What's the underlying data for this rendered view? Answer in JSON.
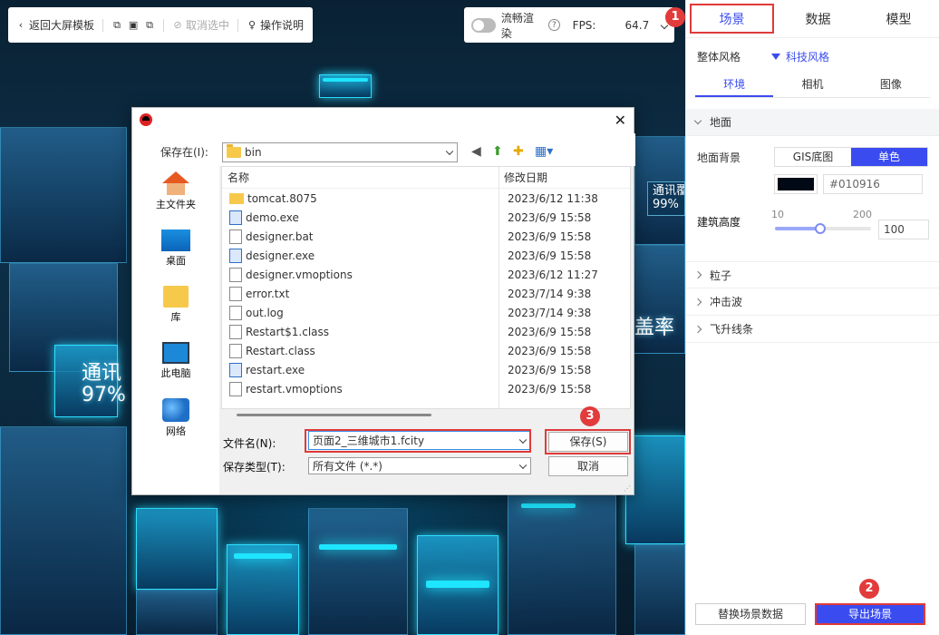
{
  "toolbar": {
    "back_label": "返回大屏模板",
    "deselect_label": "取消选中",
    "help_label": "操作说明"
  },
  "fps_bar": {
    "smooth_label": "流畅渲染",
    "fps_label": "FPS:",
    "fps_value": "64.7"
  },
  "scene_labels": {
    "label_1_title": "通讯",
    "label_1_value": "97%",
    "label_2_title": "通讯覆",
    "label_2_value": "99%",
    "label_3": "盖率"
  },
  "panel": {
    "tabs": [
      "场景",
      "数据",
      "模型"
    ],
    "style_label": "整体风格",
    "style_value": "科技风格",
    "subtabs": [
      "环境",
      "相机",
      "图像"
    ],
    "ground_section": "地面",
    "ground_bg_label": "地面背景",
    "ground_bg_options": [
      "GIS底图",
      "单色"
    ],
    "ground_color": "#010916",
    "ground_hex": "#010916",
    "building_height_label": "建筑高度",
    "slider_min": "10",
    "slider_max": "200",
    "building_height_value": "100",
    "slider_fraction": 0.47,
    "sections": [
      "粒子",
      "冲击波",
      "飞升线条"
    ],
    "replace_button": "替换场景数据",
    "export_button": "导出场景"
  },
  "badges": [
    "1",
    "2",
    "3"
  ],
  "dialog": {
    "save_in_label": "保存在(I):",
    "current_folder": "bin",
    "places": [
      "主文件夹",
      "桌面",
      "库",
      "此电脑",
      "网络"
    ],
    "col_name": "名称",
    "col_date": "修改日期",
    "files": [
      {
        "name": "tomcat.8075",
        "date": "2023/6/12 11:38",
        "icon": "folder"
      },
      {
        "name": "demo.exe",
        "date": "2023/6/9 15:58",
        "icon": "exe"
      },
      {
        "name": "designer.bat",
        "date": "2023/6/9 15:58",
        "icon": "bat"
      },
      {
        "name": "designer.exe",
        "date": "2023/6/9 15:58",
        "icon": "exe"
      },
      {
        "name": "designer.vmoptions",
        "date": "2023/6/12 11:27",
        "icon": "file"
      },
      {
        "name": "error.txt",
        "date": "2023/7/14 9:38",
        "icon": "file"
      },
      {
        "name": "out.log",
        "date": "2023/7/14 9:38",
        "icon": "file"
      },
      {
        "name": "Restart$1.class",
        "date": "2023/6/9 15:58",
        "icon": "file"
      },
      {
        "name": "Restart.class",
        "date": "2023/6/9 15:58",
        "icon": "file"
      },
      {
        "name": "restart.exe",
        "date": "2023/6/9 15:58",
        "icon": "exe"
      },
      {
        "name": "restart.vmoptions",
        "date": "2023/6/9 15:58",
        "icon": "file"
      }
    ],
    "filename_label": "文件名(N):",
    "filename_value": "页面2_三维城市1.fcity",
    "filetype_label": "保存类型(T):",
    "filetype_value": "所有文件 (*.*)",
    "save_button": "保存(S)",
    "cancel_button": "取消"
  },
  "colors": {
    "accent": "#3a4cf0",
    "highlight_red": "#e03a3a"
  }
}
